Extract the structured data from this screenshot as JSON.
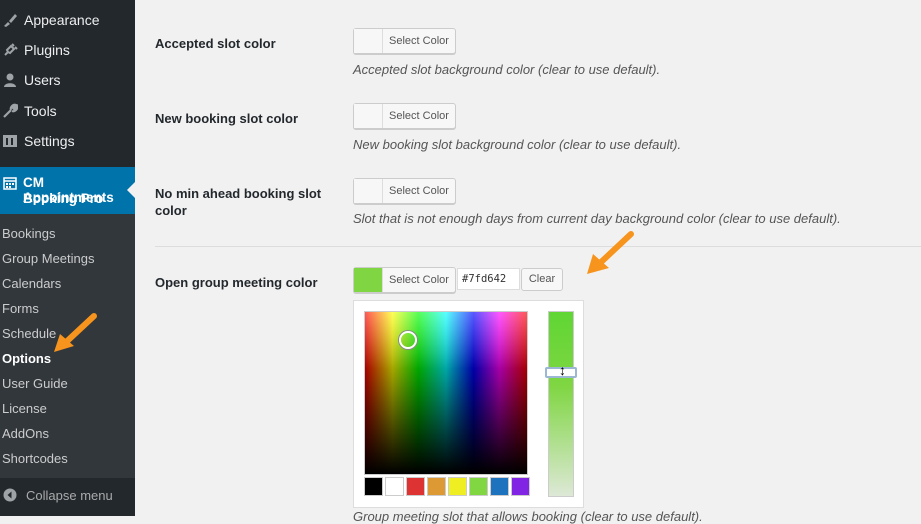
{
  "sidebar": {
    "items": [
      {
        "label": "Appearance",
        "icon": "paintbrush-icon"
      },
      {
        "label": "Plugins",
        "icon": "plugin-icon"
      },
      {
        "label": "Users",
        "icon": "users-icon"
      },
      {
        "label": "Tools",
        "icon": "wrench-icon"
      },
      {
        "label": "Settings",
        "icon": "settings-icon"
      }
    ],
    "active": {
      "line1": "CM Appointments",
      "line2": "Booking Pro",
      "icon": "calendar-icon"
    },
    "submenu": [
      "Bookings",
      "Group Meetings",
      "Calendars",
      "Forms",
      "Schedule",
      "Options",
      "User Guide",
      "License",
      "AddOns",
      "Shortcodes"
    ],
    "current_submenu": "Options",
    "collapse_label": "Collapse menu"
  },
  "main": {
    "rows": [
      {
        "label": "Accepted slot color",
        "button": "Select Color",
        "description": "Accepted slot background color (clear to use default)."
      },
      {
        "label": "New booking slot color",
        "button": "Select Color",
        "description": "New booking slot background color (clear to use default)."
      },
      {
        "label_line1": "No min ahead booking slot",
        "label_line2": "color",
        "button": "Select Color",
        "description": "Slot that is not enough days from current day background color (clear to use default)."
      },
      {
        "label": "Open group meeting color",
        "button": "Select Color",
        "hex_value": "#7fd642",
        "clear_label": "Clear",
        "description": "Group meeting slot that allows booking (clear to use default)."
      }
    ]
  },
  "colors": {
    "accent": "#0073aa",
    "selected_swatch": "#7fd642",
    "arrow": "#f7941d",
    "palette": [
      "#000000",
      "#ffffff",
      "#dd3333",
      "#dd9933",
      "#eeee22",
      "#81d742",
      "#1e73be",
      "#8224e3"
    ]
  }
}
